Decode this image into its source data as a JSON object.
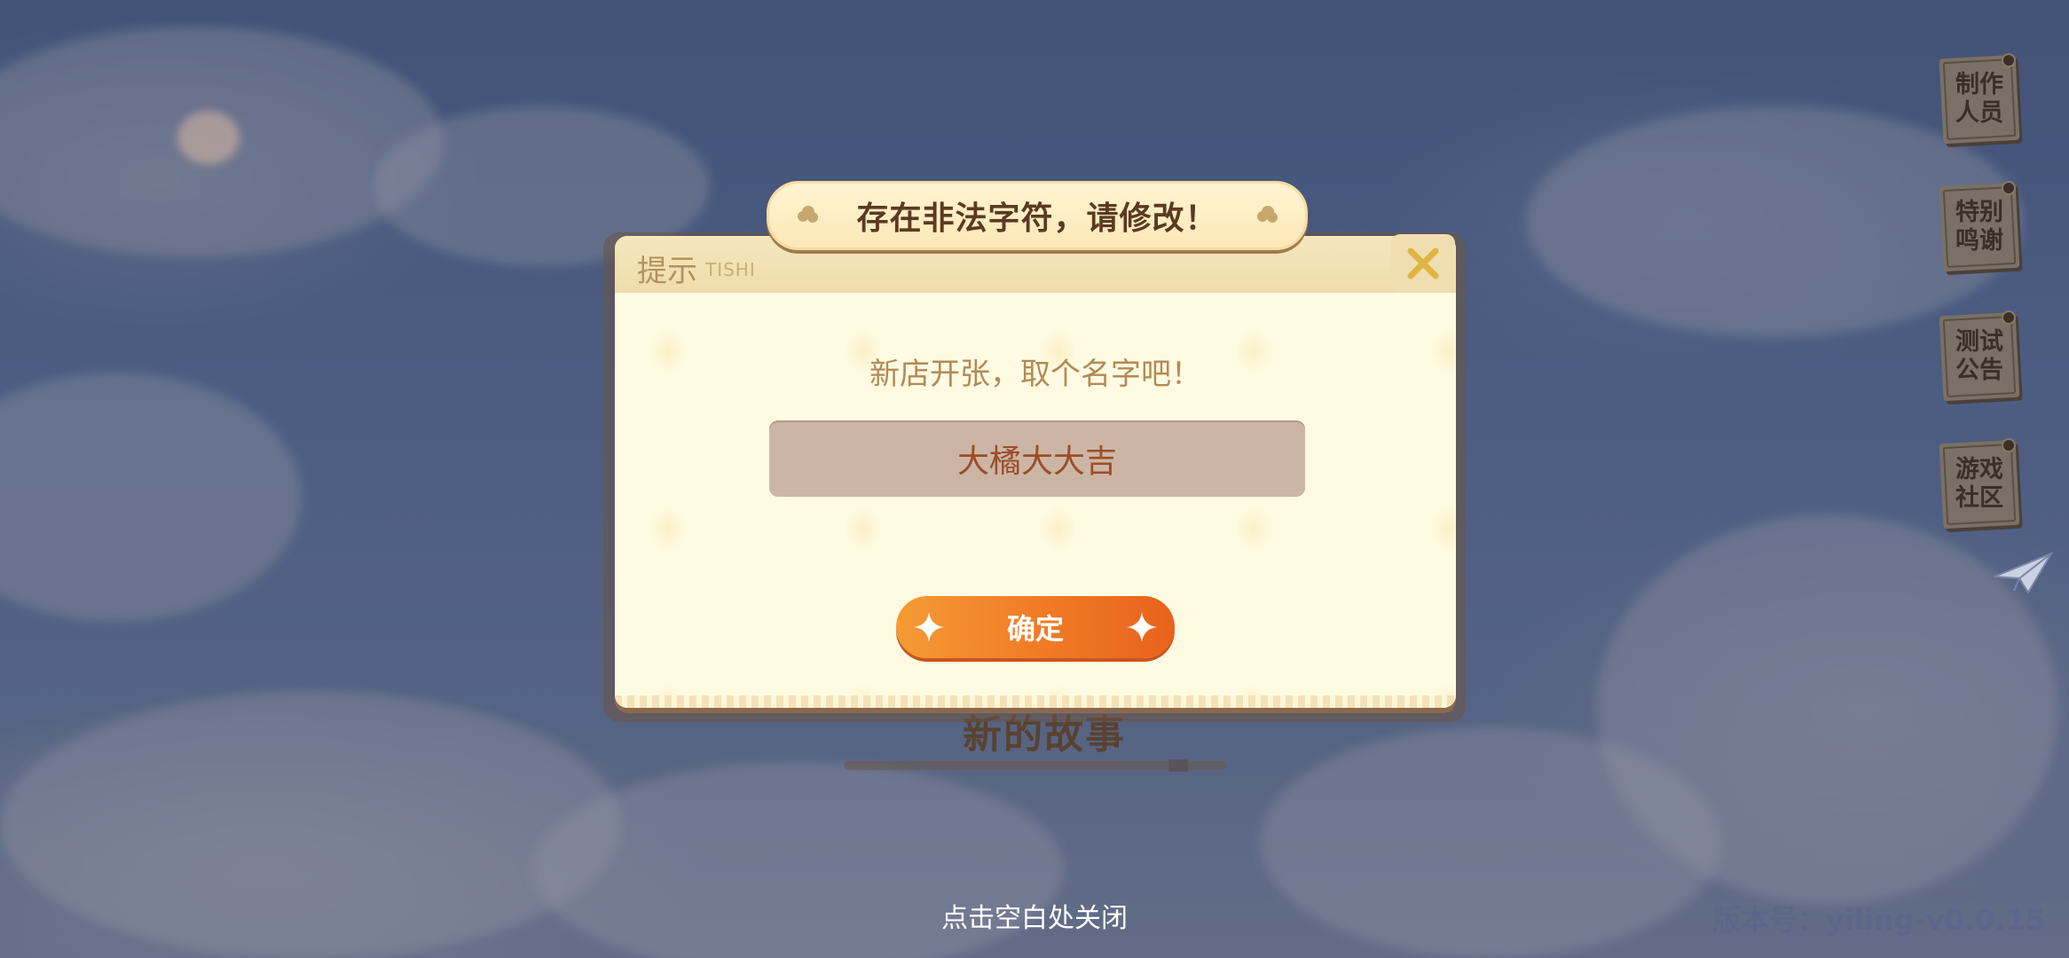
{
  "side_menu": [
    {
      "label": "制作人员"
    },
    {
      "label": "特别鸣谢"
    },
    {
      "label": "测试公告"
    },
    {
      "label": "游戏社区"
    }
  ],
  "background": {
    "story_title": "新的故事"
  },
  "toast": {
    "message": "存在非法字符，请修改！"
  },
  "dialog": {
    "title": "提示",
    "title_en": "TISHI",
    "prompt": "新店开张，取个名字吧！",
    "name_input_value": "大橘大大吉",
    "confirm_label": "确定"
  },
  "footer": {
    "tap_to_close": "点击空白处关闭",
    "version": "版本号：yiling-v0.0.15"
  },
  "icons": {
    "close": "close-icon",
    "paper_plane": "paper-plane-icon",
    "sparkle": "sparkle-icon",
    "cloud": "cloud-icon"
  },
  "colors": {
    "accent_orange": "#f07a25",
    "dialog_bg": "#fffbe2",
    "input_bg": "#cdb5a5"
  }
}
